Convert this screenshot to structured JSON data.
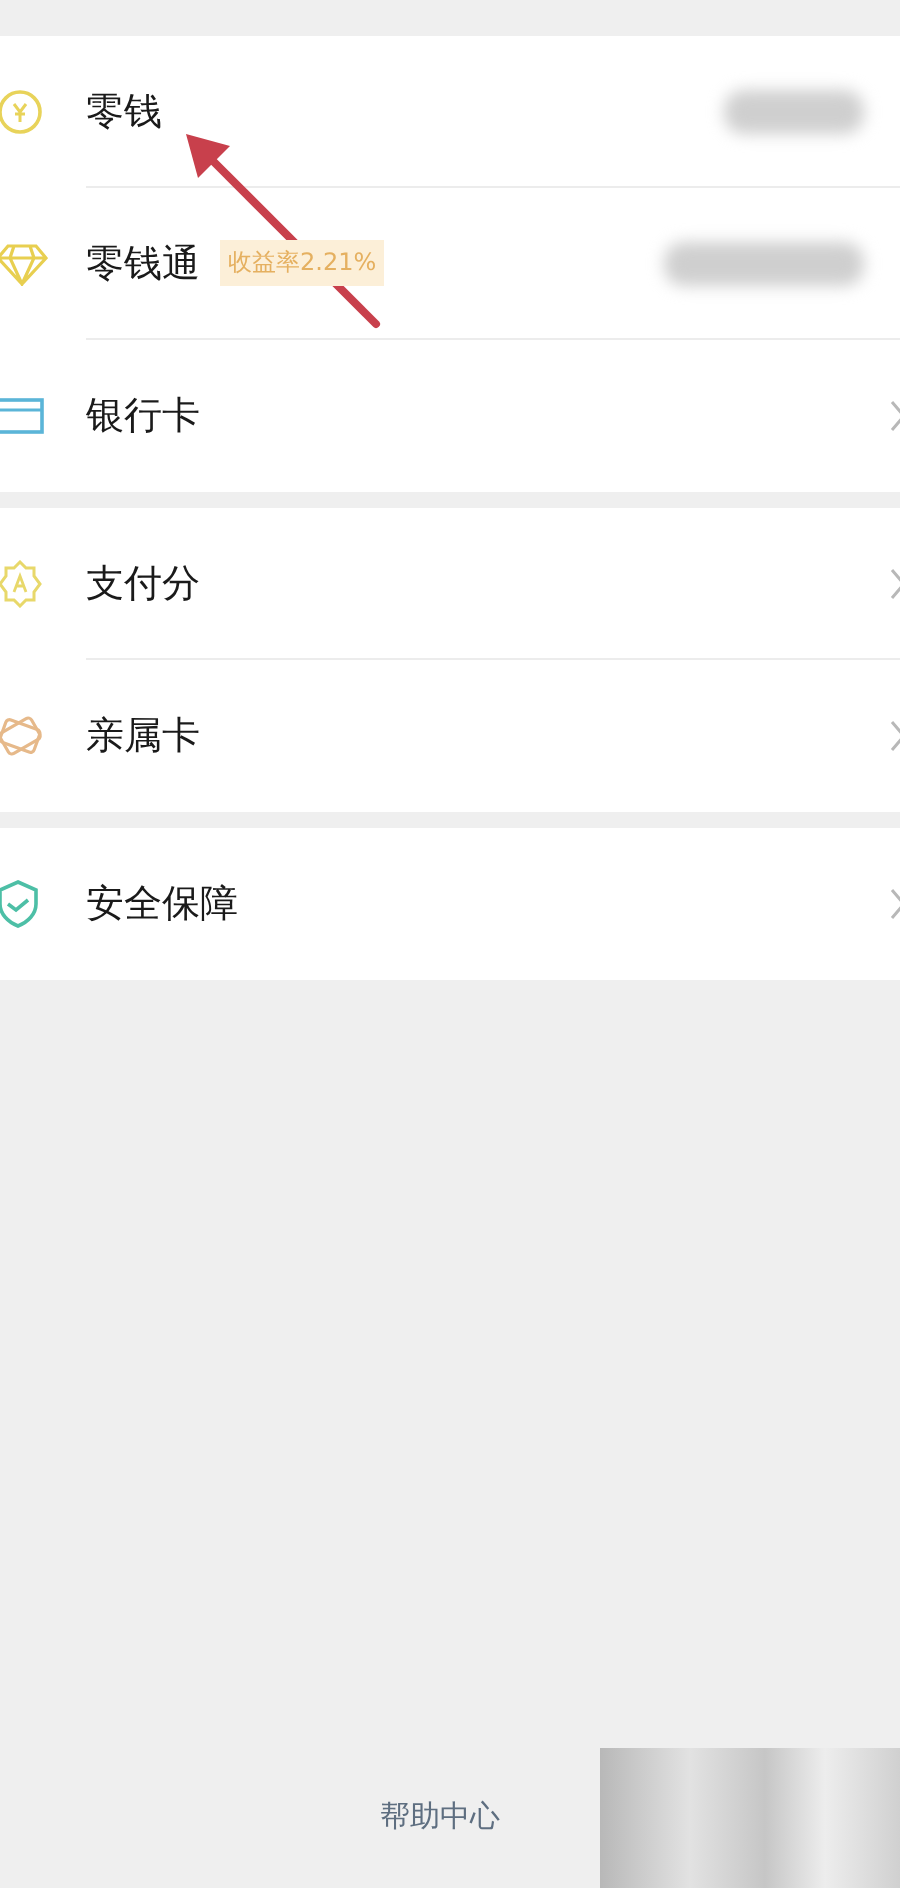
{
  "groups": [
    {
      "items": [
        {
          "kind": "balance",
          "label": "零钱"
        },
        {
          "kind": "balance",
          "label": "零钱通",
          "badge": "收益率2.21%"
        },
        {
          "kind": "link",
          "label": "银行卡"
        }
      ]
    },
    {
      "items": [
        {
          "kind": "link",
          "label": "支付分"
        },
        {
          "kind": "link",
          "label": "亲属卡"
        }
      ]
    },
    {
      "items": [
        {
          "kind": "link",
          "label": "安全保障"
        }
      ]
    }
  ],
  "footer": {
    "link": "帮助中心"
  }
}
